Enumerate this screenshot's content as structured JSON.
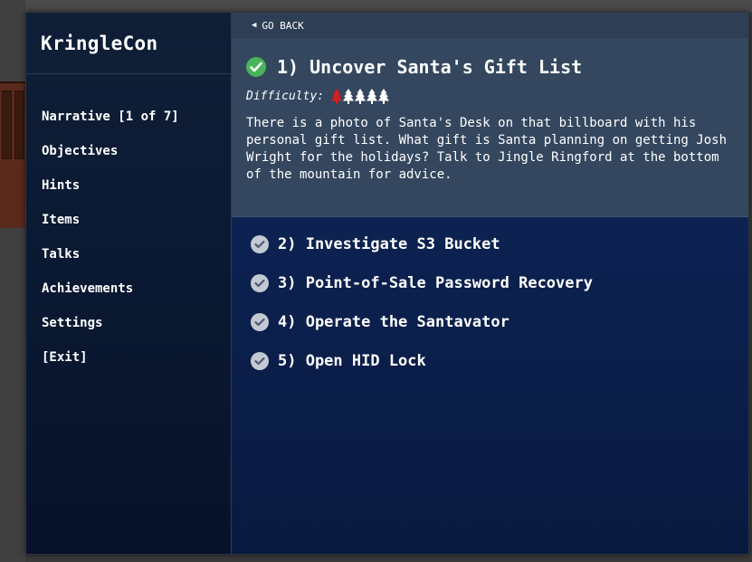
{
  "brand": "KringleCon",
  "sidebar": {
    "items": [
      {
        "name": "sidebar-item-narrative",
        "label": "Narrative [1 of 7]"
      },
      {
        "name": "sidebar-item-objectives",
        "label": "Objectives"
      },
      {
        "name": "sidebar-item-hints",
        "label": "Hints"
      },
      {
        "name": "sidebar-item-items",
        "label": "Items"
      },
      {
        "name": "sidebar-item-talks",
        "label": "Talks"
      },
      {
        "name": "sidebar-item-achievements",
        "label": "Achievements"
      },
      {
        "name": "sidebar-item-settings",
        "label": "Settings"
      },
      {
        "name": "sidebar-item-exit",
        "label": "[Exit]"
      }
    ]
  },
  "go_back": "GO BACK",
  "active_objective": {
    "title": "1) Uncover Santa's Gift List",
    "difficulty_label": "Difficulty:",
    "difficulty_level": 1,
    "difficulty_max": 5,
    "description": "There is a photo of Santa's Desk on that billboard with his personal gift list. What gift is Santa planning on getting Josh Wright for the holidays? Talk to Jingle Ringford at the bottom of the mountain for advice.",
    "status": "completed"
  },
  "objectives": [
    {
      "label": "2) Investigate S3 Bucket"
    },
    {
      "label": "3) Point-of-Sale Password Recovery"
    },
    {
      "label": "4) Operate the Santavator"
    },
    {
      "label": "5) Open HID Lock"
    }
  ],
  "colors": {
    "check_done": "#47b35a",
    "difficulty_active": "#d21f1f",
    "difficulty_inactive": "#ffffff"
  }
}
